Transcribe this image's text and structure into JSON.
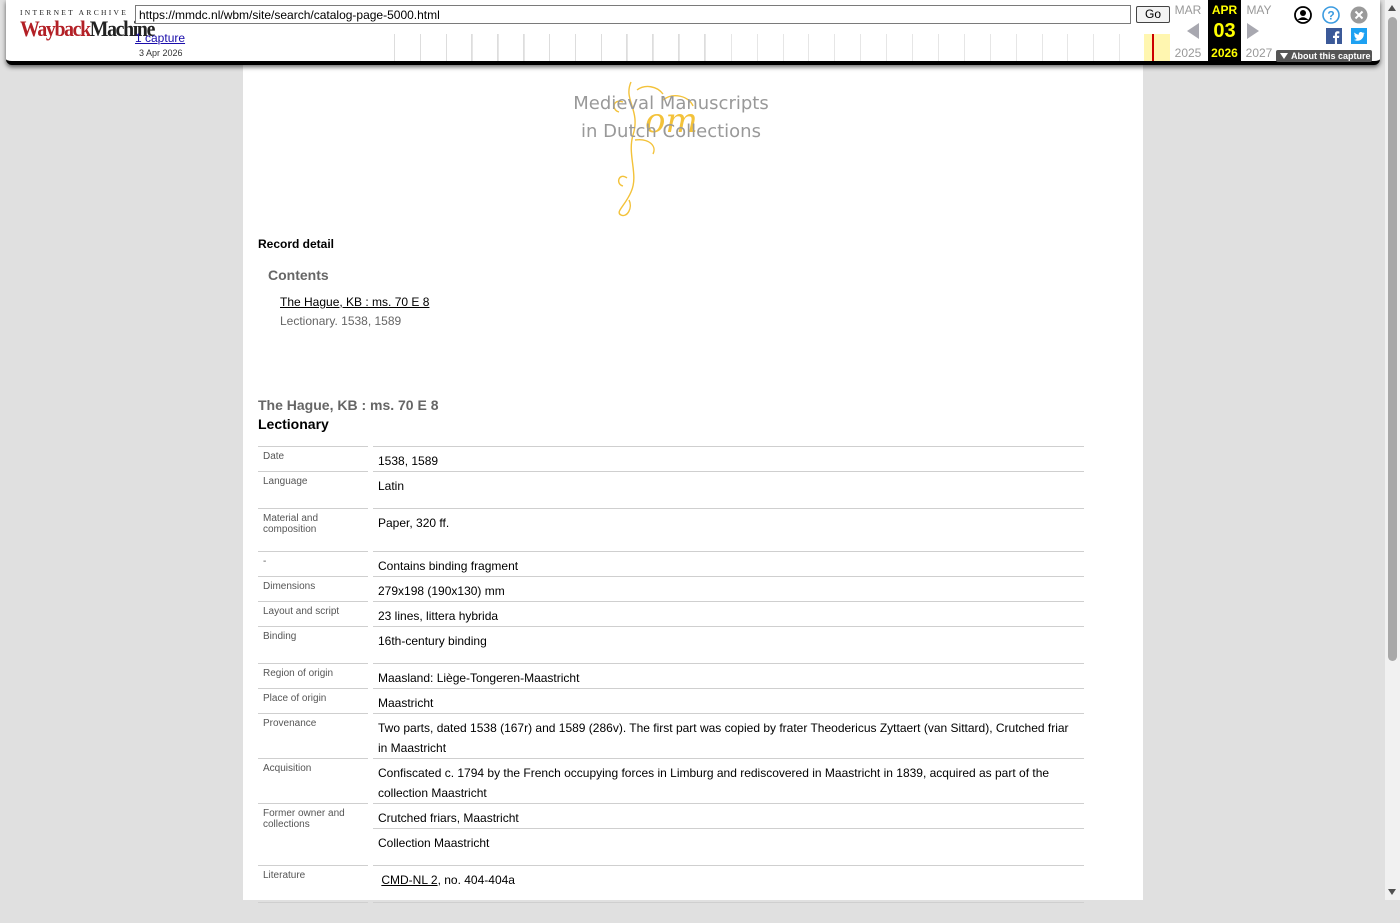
{
  "wayback": {
    "logo_top": "INTERNET ARCHIVE",
    "logo_way": "Wayback",
    "logo_machine": "Machine",
    "url": "https://mmdc.nl/wbm/site/search/catalog-page-5000.html",
    "go_label": "Go",
    "captures_label": "1 capture",
    "capture_date": "3 Apr 2026",
    "prev_month": "MAR",
    "prev_year": "2025",
    "cur_month": "APR",
    "cur_day": "03",
    "cur_year": "2026",
    "next_month": "MAY",
    "next_year": "2027",
    "about_label": "About this capture",
    "accent_color": "#ffff00"
  },
  "site": {
    "logo_line1": "Medieval Manuscripts",
    "logo_line2": "in Dutch Collections"
  },
  "record": {
    "heading": "Record detail",
    "contents_heading": "Contents",
    "contents_link": "The Hague, KB : ms. 70 E 8",
    "contents_sub": "Lectionary. 1538, 1589",
    "ms_title": "The Hague, KB : ms. 70 E 8",
    "ms_type": "Lectionary",
    "rows": [
      {
        "label": "Date",
        "value": "1538, 1589"
      },
      {
        "label": "Language",
        "value": "Latin"
      },
      {
        "label": "Material and composition",
        "value": "Paper, 320 ff."
      },
      {
        "label": "-",
        "value": "Contains binding fragment"
      },
      {
        "label": "Dimensions",
        "value": "279x198 (190x130) mm"
      },
      {
        "label": "Layout and script",
        "value": "23 lines, littera hybrida"
      },
      {
        "label": "Binding",
        "value": "16th-century binding"
      },
      {
        "label": "Region of origin",
        "value": "Maasland: Liège-Tongeren-Maastricht"
      },
      {
        "label": "Place of origin",
        "value": "Maastricht"
      },
      {
        "label": "Provenance",
        "value": "Two parts, dated 1538 (167r) and 1589 (286v). The first part was copied by frater Theodericus Zyttaert (van Sittard), Crutched friar in Maastricht"
      },
      {
        "label": "Acquisition",
        "value": "Confiscated c. 1794 by the French occupying forces in Limburg and rediscovered in Maastricht in 1839, acquired as part of the collection Maastricht"
      },
      {
        "label": "Former owner and collections",
        "value": "Crutched friars, Maastricht"
      },
      {
        "label": "",
        "value": "Collection Maastricht"
      },
      {
        "label": "Literature",
        "link": "CMD-NL 2",
        "value": ", no. 404-404a"
      }
    ]
  }
}
